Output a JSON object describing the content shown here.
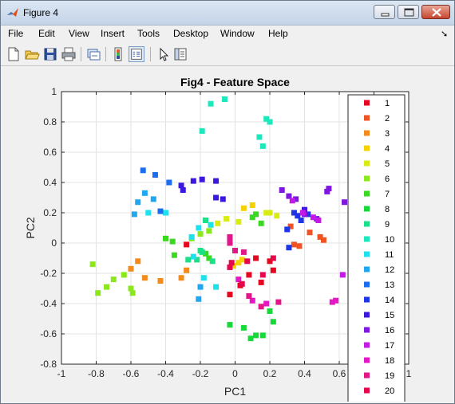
{
  "window": {
    "title": "Figure 4",
    "close_color": "#c7462e"
  },
  "menu": [
    "File",
    "Edit",
    "View",
    "Insert",
    "Tools",
    "Desktop",
    "Window",
    "Help"
  ],
  "toolbar_icons": [
    "new-figure-icon",
    "open-file-icon",
    "save-icon",
    "print-icon",
    "link-plot-icon",
    "insert-colorbar-icon",
    "insert-legend-icon",
    "edit-plot-icon",
    "property-inspector-icon"
  ],
  "chart_data": {
    "type": "scatter",
    "title": "Fig4 - Feature Space",
    "xlabel": "PC1",
    "ylabel": "PC2",
    "xlim": [
      -1,
      1
    ],
    "ylim": [
      -0.8,
      1
    ],
    "xticks": [
      "-1",
      "-0.8",
      "-0.6",
      "-0.4",
      "-0.2",
      "0",
      "0.2",
      "0.4",
      "0.6",
      "0.8",
      "1"
    ],
    "yticks": [
      "-0.8",
      "-0.6",
      "-0.4",
      "-0.2",
      "0",
      "0.2",
      "0.4",
      "0.6",
      "0.8",
      "1"
    ],
    "grid": true,
    "legend_position": "right inside",
    "marker": "square",
    "series": [
      {
        "name": "1",
        "color": "#e6061f",
        "points": [
          [
            0.2,
            -0.12
          ],
          [
            0.22,
            -0.18
          ],
          [
            0.15,
            -0.26
          ],
          [
            0.03,
            -0.28
          ],
          [
            0.08,
            -0.21
          ],
          [
            -0.03,
            -0.34
          ],
          [
            0.12,
            -0.1
          ],
          [
            -0.28,
            -0.01
          ]
        ]
      },
      {
        "name": "2",
        "color": "#f05222",
        "points": [
          [
            0.32,
            0.11
          ],
          [
            0.37,
            -0.02
          ],
          [
            0.43,
            0.07
          ],
          [
            0.49,
            0.04
          ],
          [
            0.51,
            0.02
          ],
          [
            0.34,
            -0.01
          ]
        ]
      },
      {
        "name": "3",
        "color": "#f38a1c",
        "points": [
          [
            -0.6,
            -0.17
          ],
          [
            -0.56,
            -0.12
          ],
          [
            -0.52,
            -0.23
          ],
          [
            -0.43,
            -0.25
          ],
          [
            -0.31,
            -0.23
          ],
          [
            -0.28,
            -0.18
          ]
        ]
      },
      {
        "name": "4",
        "color": "#f5d100",
        "points": [
          [
            0.05,
            0.23
          ],
          [
            0.1,
            0.25
          ],
          [
            0.02,
            -0.13
          ],
          [
            -0.01,
            -0.15
          ],
          [
            0.04,
            -0.11
          ],
          [
            -0.14,
            0.12
          ]
        ]
      },
      {
        "name": "5",
        "color": "#d8eb12",
        "points": [
          [
            0.2,
            0.2
          ],
          [
            0.02,
            0.14
          ],
          [
            -0.1,
            0.13
          ],
          [
            -0.05,
            0.16
          ],
          [
            0.18,
            0.2
          ],
          [
            0.24,
            0.18
          ]
        ]
      },
      {
        "name": "6",
        "color": "#8ce81c",
        "points": [
          [
            -0.82,
            -0.14
          ],
          [
            -0.79,
            -0.33
          ],
          [
            -0.74,
            -0.29
          ],
          [
            -0.7,
            -0.24
          ],
          [
            -0.64,
            -0.21
          ],
          [
            -0.6,
            -0.3
          ],
          [
            -0.59,
            -0.33
          ],
          [
            -0.25,
            0.03
          ],
          [
            -0.2,
            0.06
          ],
          [
            -0.15,
            0.08
          ]
        ]
      },
      {
        "name": "7",
        "color": "#3bd821",
        "points": [
          [
            -0.4,
            0.03
          ],
          [
            -0.36,
            0.01
          ],
          [
            -0.35,
            -0.08
          ],
          [
            0.1,
            0.17
          ],
          [
            0.15,
            0.13
          ],
          [
            0.12,
            0.19
          ],
          [
            -0.17,
            -0.07
          ],
          [
            -0.15,
            -0.1
          ]
        ]
      },
      {
        "name": "8",
        "color": "#18d93a",
        "points": [
          [
            -0.03,
            -0.54
          ],
          [
            0.05,
            -0.56
          ],
          [
            0.09,
            -0.63
          ],
          [
            0.12,
            -0.61
          ],
          [
            0.16,
            -0.61
          ],
          [
            0.2,
            -0.45
          ],
          [
            0.22,
            -0.52
          ]
        ]
      },
      {
        "name": "9",
        "color": "#1be088",
        "points": [
          [
            -0.17,
            0.15
          ],
          [
            -0.2,
            -0.05
          ],
          [
            -0.19,
            -0.06
          ],
          [
            -0.22,
            -0.11
          ],
          [
            -0.27,
            -0.11
          ],
          [
            -0.13,
            -0.12
          ]
        ]
      },
      {
        "name": "10",
        "color": "#1de8bb",
        "points": [
          [
            -0.14,
            0.92
          ],
          [
            -0.06,
            0.95
          ],
          [
            -0.19,
            0.74
          ],
          [
            0.14,
            0.7
          ],
          [
            0.16,
            0.64
          ],
          [
            0.18,
            0.82
          ],
          [
            0.2,
            0.8
          ]
        ]
      },
      {
        "name": "11",
        "color": "#1de2ee",
        "points": [
          [
            -0.5,
            0.2
          ],
          [
            -0.4,
            0.2
          ],
          [
            -0.25,
            0.04
          ],
          [
            -0.21,
            0.1
          ],
          [
            -0.24,
            -0.09
          ],
          [
            -0.14,
            0.12
          ],
          [
            -0.18,
            -0.23
          ],
          [
            -0.11,
            -0.29
          ]
        ]
      },
      {
        "name": "12",
        "color": "#1fa8f0",
        "points": [
          [
            -0.56,
            0.27
          ],
          [
            -0.52,
            0.33
          ],
          [
            -0.58,
            0.19
          ],
          [
            -0.47,
            0.29
          ],
          [
            -0.2,
            -0.29
          ],
          [
            -0.21,
            -0.37
          ]
        ]
      },
      {
        "name": "13",
        "color": "#1c6cf0",
        "points": [
          [
            -0.53,
            0.48
          ],
          [
            -0.46,
            0.45
          ],
          [
            -0.43,
            0.21
          ],
          [
            -0.38,
            0.4
          ]
        ]
      },
      {
        "name": "14",
        "color": "#1f36e6",
        "points": [
          [
            0.3,
            0.09
          ],
          [
            0.34,
            0.2
          ],
          [
            0.38,
            0.15
          ],
          [
            0.42,
            0.19
          ],
          [
            0.36,
            0.18
          ],
          [
            0.31,
            -0.03
          ]
        ]
      },
      {
        "name": "15",
        "color": "#3d17df",
        "points": [
          [
            -0.31,
            0.38
          ],
          [
            -0.24,
            0.41
          ],
          [
            -0.19,
            0.42
          ],
          [
            -0.11,
            0.41
          ],
          [
            -0.11,
            0.3
          ],
          [
            -0.07,
            0.29
          ],
          [
            -0.3,
            0.35
          ],
          [
            0.4,
            0.22
          ]
        ]
      },
      {
        "name": "16",
        "color": "#8016e3",
        "points": [
          [
            0.27,
            0.35
          ],
          [
            0.31,
            0.31
          ],
          [
            0.35,
            0.29
          ],
          [
            0.4,
            0.19
          ],
          [
            0.47,
            0.16
          ],
          [
            0.53,
            0.34
          ],
          [
            0.54,
            0.36
          ],
          [
            0.63,
            0.27
          ]
        ]
      },
      {
        "name": "17",
        "color": "#c519e6",
        "points": [
          [
            0.33,
            0.28
          ],
          [
            0.39,
            0.2
          ],
          [
            0.45,
            0.17
          ],
          [
            0.48,
            0.15
          ],
          [
            0.62,
            -0.21
          ]
        ]
      },
      {
        "name": "18",
        "color": "#e417c4",
        "points": [
          [
            0.56,
            -0.39
          ],
          [
            0.58,
            -0.38
          ],
          [
            -0.03,
            0.03
          ],
          [
            0.02,
            -0.24
          ],
          [
            0.1,
            -0.38
          ],
          [
            0.18,
            -0.4
          ]
        ]
      },
      {
        "name": "19",
        "color": "#e31688",
        "points": [
          [
            -0.03,
            0.04
          ],
          [
            -0.03,
            0.0
          ],
          [
            0.05,
            -0.06
          ],
          [
            0.0,
            -0.05
          ],
          [
            0.08,
            -0.35
          ],
          [
            0.15,
            -0.42
          ],
          [
            0.25,
            -0.39
          ]
        ]
      },
      {
        "name": "20",
        "color": "#e6064b",
        "points": [
          [
            0.07,
            -0.12
          ],
          [
            0.04,
            -0.27
          ],
          [
            0.16,
            -0.21
          ],
          [
            0.22,
            -0.1
          ],
          [
            -0.02,
            -0.13
          ],
          [
            -0.03,
            -0.16
          ]
        ]
      }
    ]
  }
}
